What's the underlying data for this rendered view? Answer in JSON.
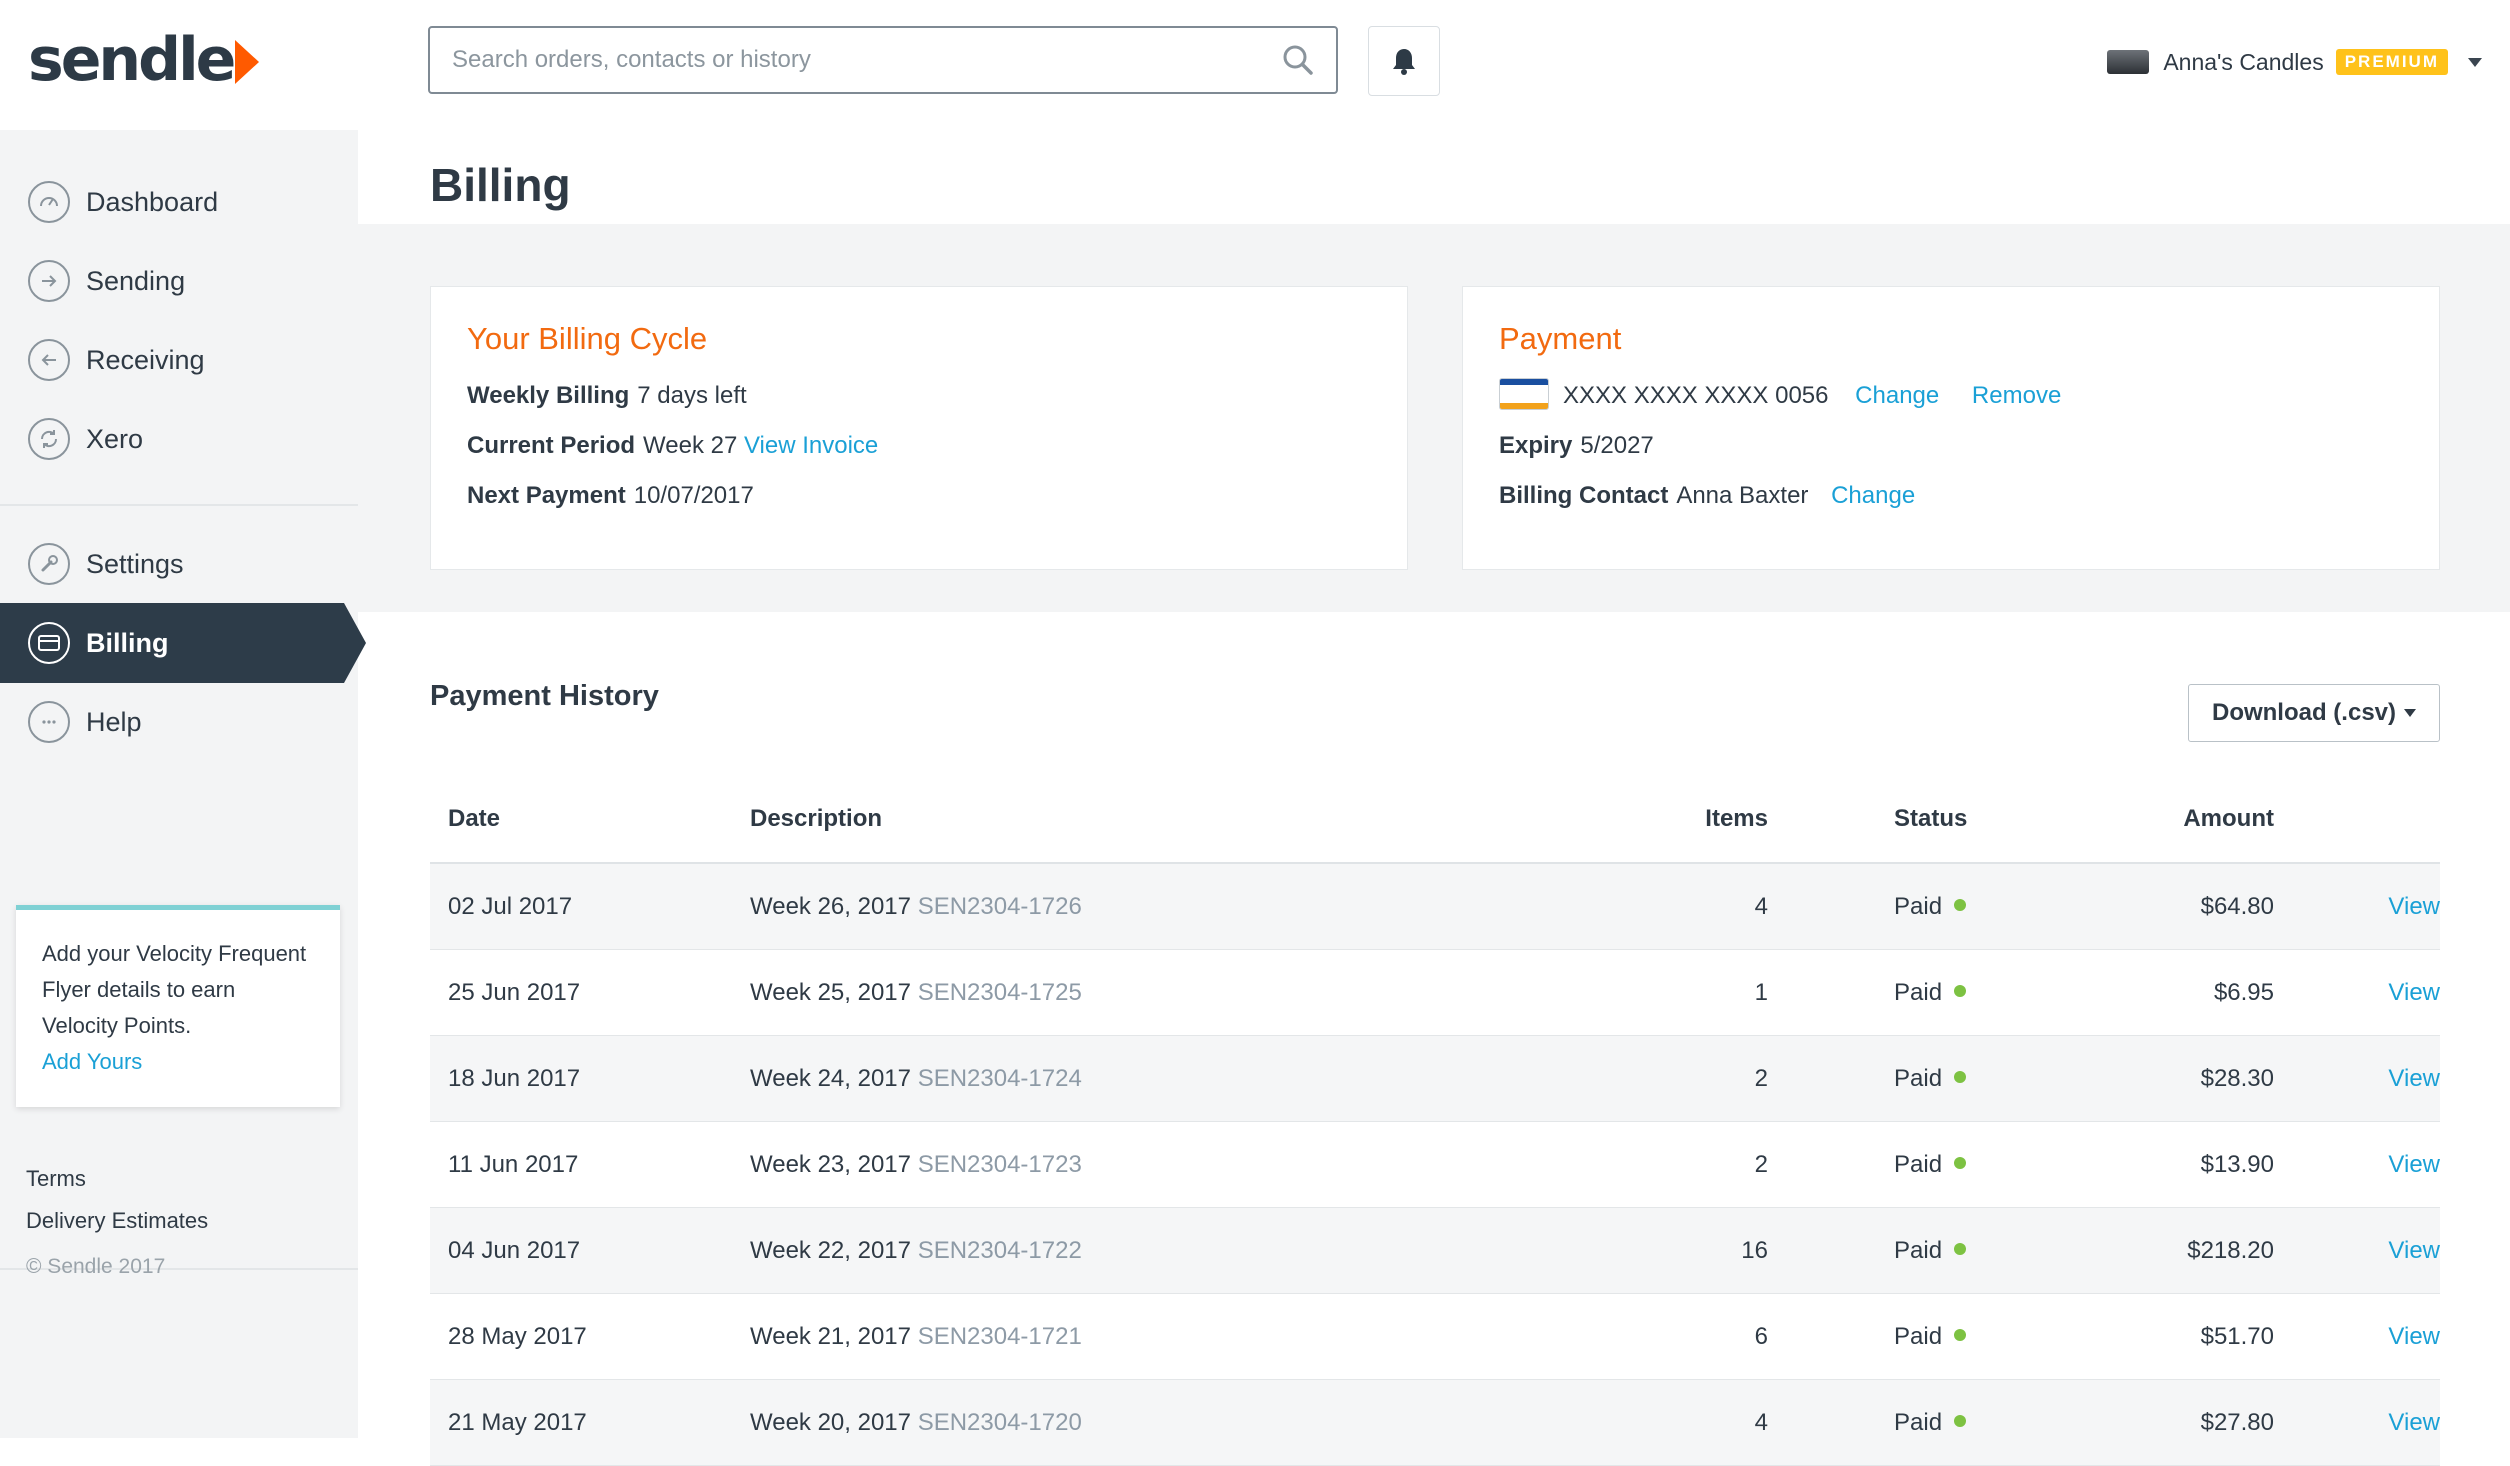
{
  "brand": {
    "logo_text": "sendle",
    "accent": "#ff5a00"
  },
  "header": {
    "search_placeholder": "Search orders, contacts or history",
    "account_name": "Anna's Candles",
    "badge": "PREMIUM"
  },
  "sidebar": {
    "nav": [
      {
        "label": "Dashboard",
        "icon": "gauge-icon"
      },
      {
        "label": "Sending",
        "icon": "arrow-right-circle-icon"
      },
      {
        "label": "Receiving",
        "icon": "arrow-left-circle-icon"
      },
      {
        "label": "Xero",
        "icon": "sync-icon"
      },
      {
        "label": "Settings",
        "icon": "wrench-icon"
      },
      {
        "label": "Billing",
        "icon": "credit-card-icon",
        "active": true
      },
      {
        "label": "Help",
        "icon": "chat-bubble-icon"
      }
    ],
    "promo": {
      "text": "Add your Velocity Frequent Flyer details to earn Velocity Points.",
      "link": "Add Yours"
    },
    "footer": {
      "terms": "Terms",
      "delivery": "Delivery Estimates",
      "copyright": "© Sendle 2017"
    }
  },
  "page": {
    "title": "Billing"
  },
  "billing_cycle": {
    "title": "Your Billing Cycle",
    "weekly_label": "Weekly Billing",
    "weekly_value": "7 days left",
    "period_label": "Current Period",
    "period_value": "Week 27",
    "view_invoice": "View Invoice",
    "next_label": "Next Payment",
    "next_value": "10/07/2017"
  },
  "payment": {
    "title": "Payment",
    "card_brand": "VISA",
    "card_number": "XXXX XXXX XXXX 0056",
    "change": "Change",
    "remove": "Remove",
    "expiry_label": "Expiry",
    "expiry_value": "5/2027",
    "contact_label": "Billing Contact",
    "contact_value": "Anna Baxter",
    "contact_change": "Change"
  },
  "history": {
    "title": "Payment History",
    "download": "Download (.csv)",
    "columns": {
      "date": "Date",
      "description": "Description",
      "items": "Items",
      "status": "Status",
      "amount": "Amount"
    },
    "rows": [
      {
        "date": "02 Jul 2017",
        "week": "Week 26, 2017",
        "ref": "SEN2304-1726",
        "items": "4",
        "status": "Paid",
        "amount": "$64.80",
        "action": "View"
      },
      {
        "date": "25 Jun 2017",
        "week": "Week 25, 2017",
        "ref": "SEN2304-1725",
        "items": "1",
        "status": "Paid",
        "amount": "$6.95",
        "action": "View"
      },
      {
        "date": "18 Jun 2017",
        "week": "Week 24, 2017",
        "ref": "SEN2304-1724",
        "items": "2",
        "status": "Paid",
        "amount": "$28.30",
        "action": "View"
      },
      {
        "date": "11 Jun 2017",
        "week": "Week 23, 2017",
        "ref": "SEN2304-1723",
        "items": "2",
        "status": "Paid",
        "amount": "$13.90",
        "action": "View"
      },
      {
        "date": "04 Jun 2017",
        "week": "Week 22, 2017",
        "ref": "SEN2304-1722",
        "items": "16",
        "status": "Paid",
        "amount": "$218.20",
        "action": "View"
      },
      {
        "date": "28 May 2017",
        "week": "Week 21, 2017",
        "ref": "SEN2304-1721",
        "items": "6",
        "status": "Paid",
        "amount": "$51.70",
        "action": "View"
      },
      {
        "date": "21 May 2017",
        "week": "Week 20, 2017",
        "ref": "SEN2304-1720",
        "items": "4",
        "status": "Paid",
        "amount": "$27.80",
        "action": "View"
      }
    ]
  }
}
